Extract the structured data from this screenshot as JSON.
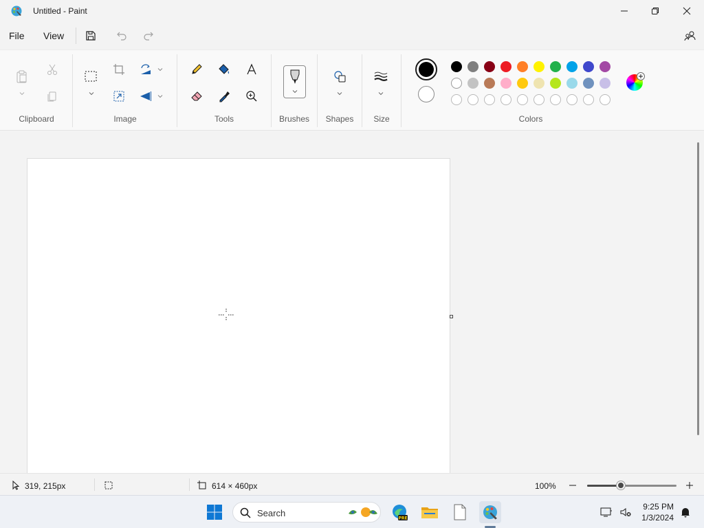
{
  "window": {
    "title": "Untitled - Paint",
    "app_icon": "paint-palette-icon"
  },
  "menu": {
    "file_label": "File",
    "view_label": "View",
    "save_icon": "save-icon",
    "undo_icon": "undo-icon",
    "redo_icon": "redo-icon"
  },
  "ribbon": {
    "groups": {
      "clipboard": "Clipboard",
      "image": "Image",
      "tools": "Tools",
      "brushes": "Brushes",
      "shapes": "Shapes",
      "size": "Size",
      "colors": "Colors"
    },
    "primary_color": "#000000",
    "secondary_color": "#ffffff",
    "palette_row1": [
      "#000000",
      "#7f7f7f",
      "#880015",
      "#ed1c24",
      "#ff7f27",
      "#fff200",
      "#22b14c",
      "#00a2e8",
      "#3f48cc",
      "#a349a4"
    ],
    "palette_row2": [
      "#ffffff",
      "#c3c3c3",
      "#b97a57",
      "#ffaec9",
      "#ffc90e",
      "#efe4b0",
      "#b5e61d",
      "#99d9ea",
      "#7092be",
      "#c8bfe7"
    ],
    "palette_row3_empty_count": 10
  },
  "status": {
    "cursor_position": "319, 215px",
    "canvas_size": "614 × 460px",
    "zoom_level": "100%",
    "zoom_fraction": 0.38
  },
  "taskbar": {
    "search_placeholder": "Search",
    "time": "9:25 PM",
    "date": "1/3/2024"
  }
}
